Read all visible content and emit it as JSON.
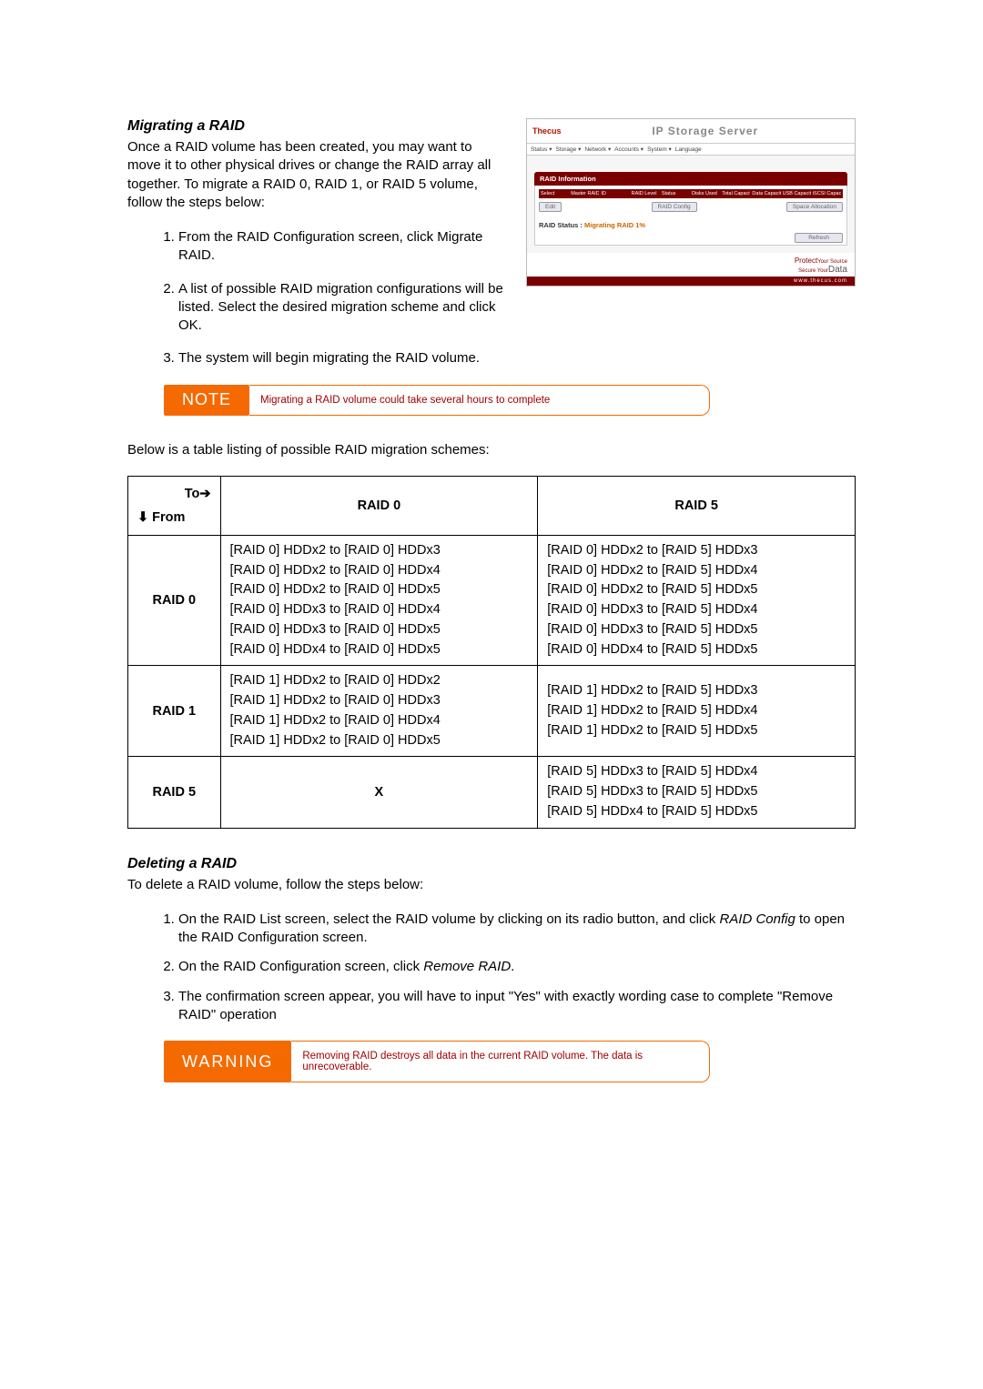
{
  "sections": {
    "migrating_title": "Migrating a RAID",
    "migrating_intro": "Once a RAID volume has been created, you may want to move it to other physical drives or change the RAID array all together. To migrate a RAID 0, RAID 1, or RAID 5 volume, follow the steps below:",
    "migrating_steps": [
      "From the RAID Configuration screen, click Migrate RAID.",
      "A list of possible RAID migration configurations will be listed. Select the desired migration scheme and click OK.",
      "The system will begin migrating the RAID volume."
    ],
    "note_label": "NOTE",
    "note_text": "Migrating a RAID volume could take several hours to complete",
    "table_intro": "Below is a table listing of possible RAID migration schemes:",
    "deleting_title": "Deleting a RAID",
    "deleting_intro": "To delete a RAID volume, follow the steps below:",
    "deleting_steps": [
      {
        "pre": "On the RAID List screen, select the RAID volume by clicking on its radio button, and click ",
        "em": "RAID Config",
        "post": " to open the RAID Configuration screen."
      },
      {
        "pre": "On the RAID Configuration screen, click ",
        "em": "Remove RAID",
        "post": "."
      },
      {
        "pre": "The confirmation screen appear, you will have to input \"Yes\" with exactly wording case to complete \"Remove RAID\" operation",
        "em": "",
        "post": ""
      }
    ],
    "warning_label": "WARNING",
    "warning_text": "Removing RAID destroys all data in the current RAID volume. The data is unrecoverable."
  },
  "table": {
    "corner_to": "To➔",
    "corner_from": "⬇ From",
    "col_headers": [
      "RAID 0",
      "RAID 5"
    ],
    "rows": [
      {
        "hdr": "RAID 0",
        "c0": [
          "[RAID 0] HDDx2 to [RAID 0] HDDx3",
          "[RAID 0] HDDx2 to [RAID 0] HDDx4",
          "[RAID 0] HDDx2 to [RAID 0] HDDx5",
          "[RAID 0] HDDx3 to [RAID 0] HDDx4",
          "[RAID 0] HDDx3 to [RAID 0] HDDx5",
          "[RAID 0] HDDx4 to [RAID 0] HDDx5"
        ],
        "c1": [
          "[RAID 0] HDDx2 to [RAID 5] HDDx3",
          "[RAID 0] HDDx2 to [RAID 5] HDDx4",
          "[RAID 0] HDDx2 to [RAID 5] HDDx5",
          "[RAID 0] HDDx3 to [RAID 5] HDDx4",
          "[RAID 0] HDDx3 to [RAID 5] HDDx5",
          "[RAID 0] HDDx4 to [RAID 5] HDDx5"
        ]
      },
      {
        "hdr": "RAID 1",
        "c0": [
          "[RAID 1] HDDx2 to [RAID 0] HDDx2",
          "[RAID 1] HDDx2 to [RAID 0] HDDx3",
          "[RAID 1] HDDx2 to [RAID 0] HDDx4",
          "[RAID 1] HDDx2 to [RAID 0] HDDx5"
        ],
        "c1": [
          "[RAID 1] HDDx2 to [RAID 5] HDDx3",
          "[RAID 1] HDDx2 to [RAID 5] HDDx4",
          "[RAID 1] HDDx2 to [RAID 5] HDDx5"
        ]
      },
      {
        "hdr": "RAID 5",
        "c0": "X",
        "c1": [
          "[RAID 5] HDDx3 to [RAID 5] HDDx4",
          "[RAID 5] HDDx3 to [RAID 5] HDDx5",
          "[RAID 5] HDDx4 to [RAID 5] HDDx5"
        ]
      }
    ]
  },
  "screenshot": {
    "logo": "Thecus",
    "title": "IP Storage Server",
    "menu": [
      "Status ▾",
      "Storage ▾",
      "Network ▾",
      "Accounts ▾",
      "System ▾",
      "Language"
    ],
    "panel_title": "RAID Information",
    "cols": [
      "Select",
      "Master RAID",
      "ID",
      "RAID Level",
      "Status",
      "Disks Used",
      "Total Capacity",
      "Data Capacity",
      "USB Capacity",
      "iSCSI Capacity"
    ],
    "btn_edit": "Edit",
    "btn_config": "RAID Config",
    "btn_alloc": "Space Allocation",
    "status_label": "RAID Status :",
    "status_value": "Migrating RAID 1%",
    "refresh": "Refresh",
    "foot_protect": "Protect",
    "foot_yoursource": "Your Source",
    "foot_secure": "Secure Your",
    "foot_data": "Data",
    "foot_url": "www.thecus.com"
  }
}
